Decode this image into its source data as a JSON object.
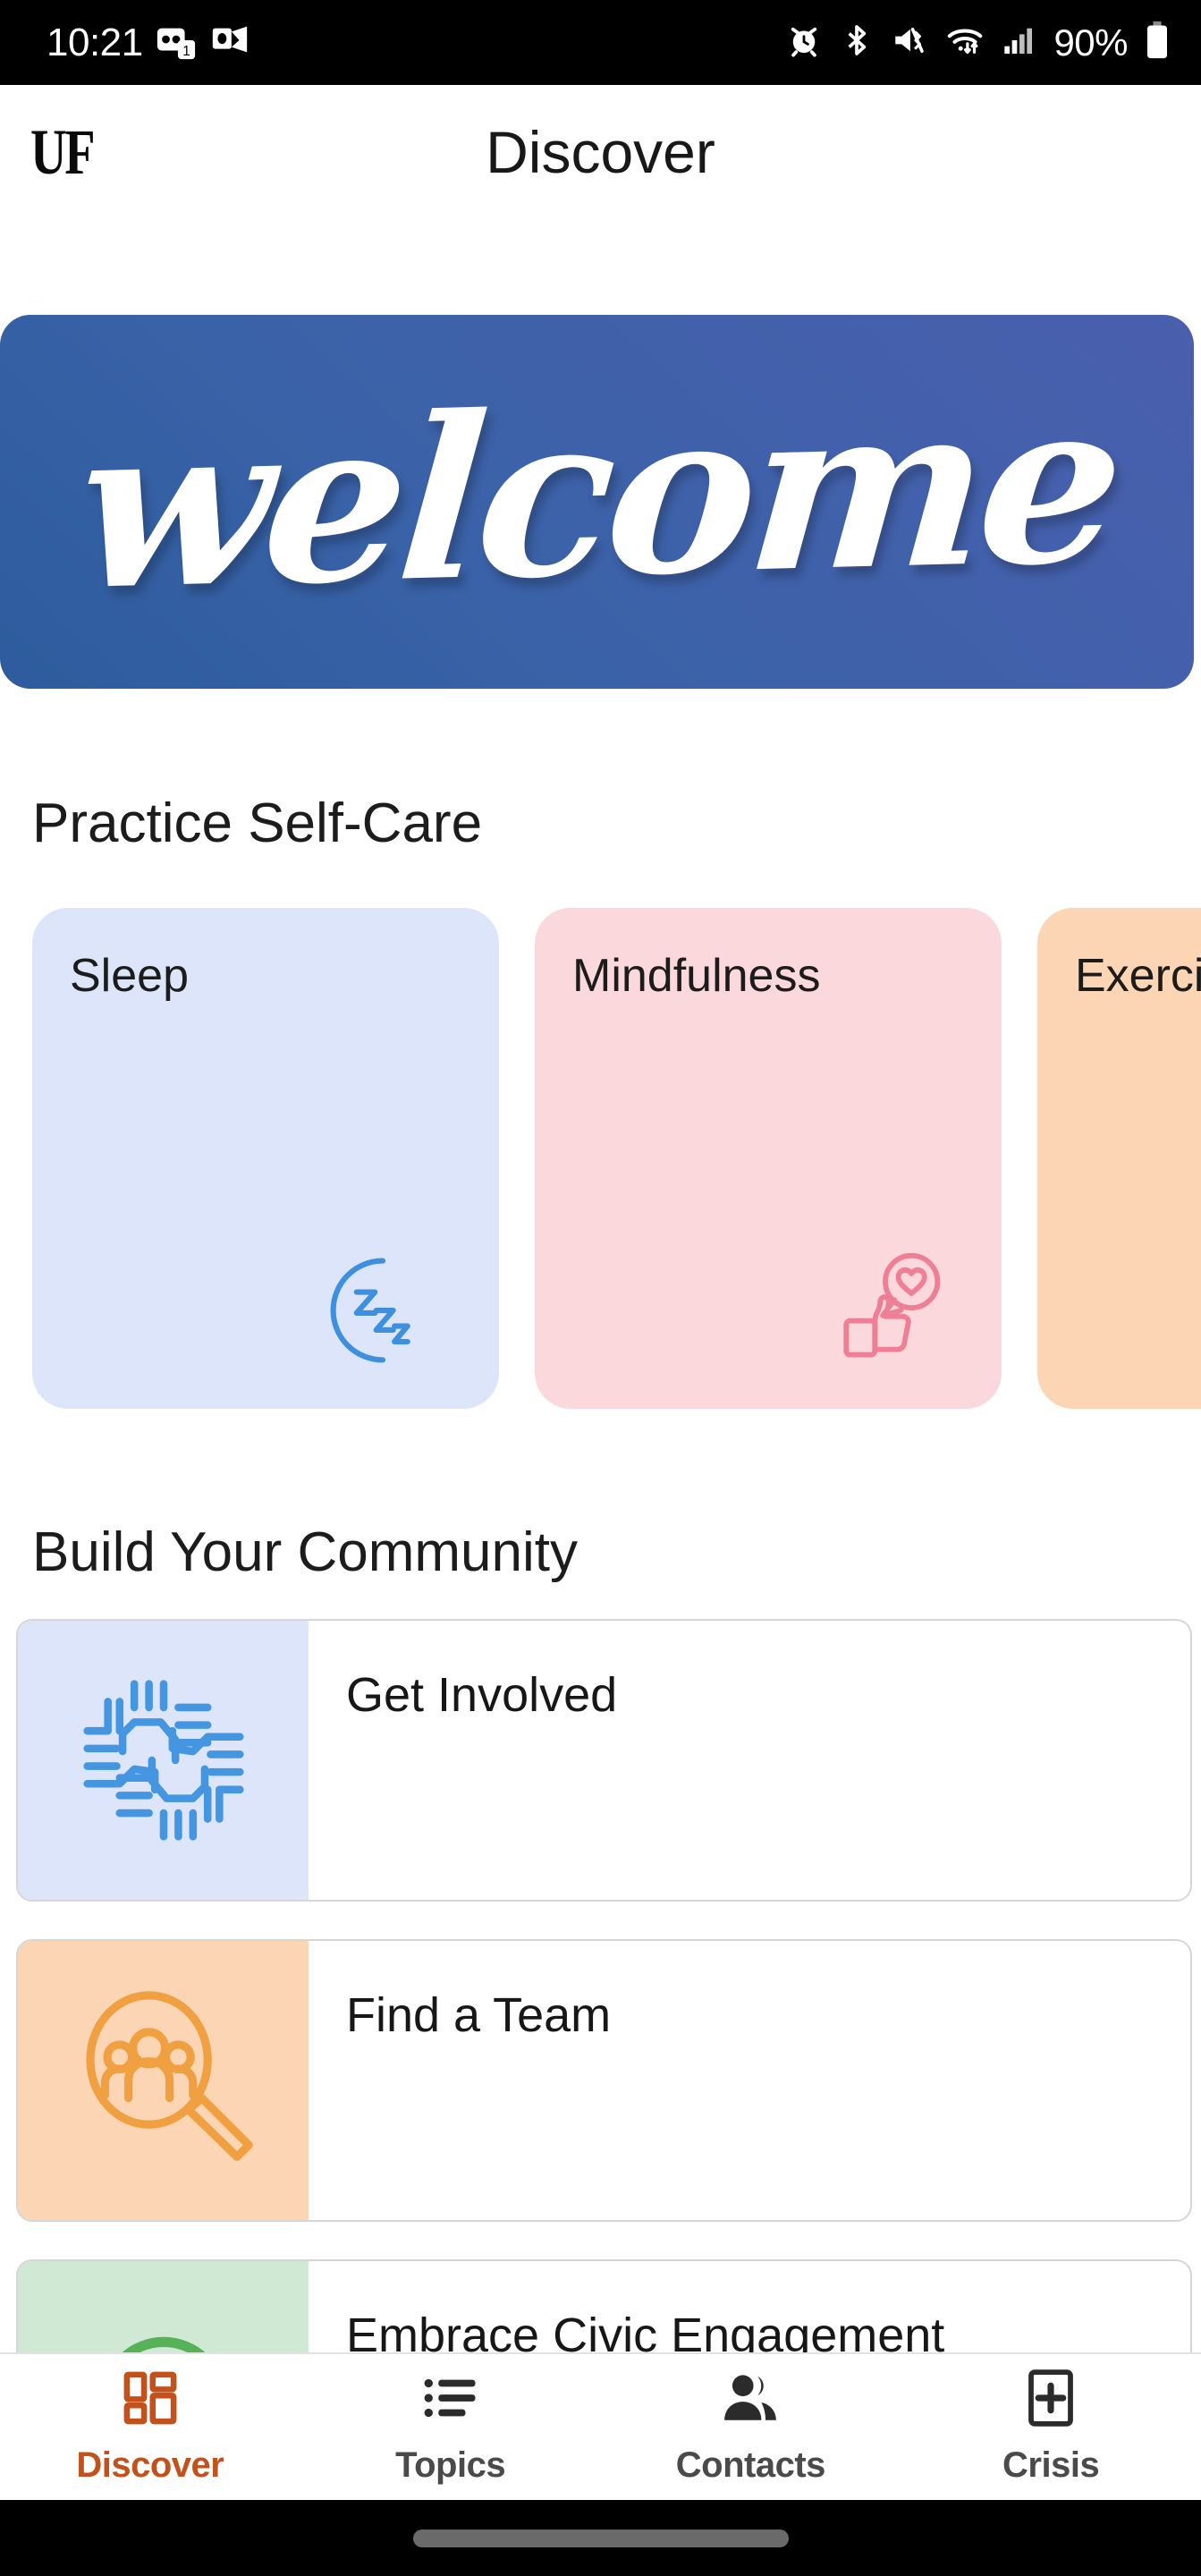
{
  "status_bar": {
    "time": "10:21",
    "battery_percent": "90%",
    "left_icons": [
      "voicemail-icon",
      "outlook-icon"
    ],
    "voicemail_badge": "1",
    "right_icons": [
      "alarm-icon",
      "bluetooth-icon",
      "mute-vibrate-icon",
      "wifi-icon",
      "cellular-signal-icon",
      "battery-icon"
    ]
  },
  "header": {
    "logo": "UF",
    "title": "Discover"
  },
  "banner": {
    "text": "welcome",
    "gradient_from": "#2d5c9d",
    "gradient_to": "#4a5fae"
  },
  "self_care": {
    "heading": "Practice Self-Care",
    "cards": [
      {
        "label": "Sleep",
        "bg": "#dde5fa",
        "accent": "#3f8fdf",
        "icon": "moon-zzz-icon"
      },
      {
        "label": "Mindfulness",
        "bg": "#fbd8dc",
        "accent": "#ef7f95",
        "icon": "thumbs-up-heart-icon"
      },
      {
        "label": "Exercise",
        "bg": "#fbd5b4",
        "accent": "#f0a040",
        "icon": "exercise-icon"
      }
    ]
  },
  "community": {
    "heading": "Build Your Community",
    "items": [
      {
        "label": "Get Involved",
        "bg": "#dde5fa",
        "accent": "#4596e0",
        "icon": "teamwork-hands-icon"
      },
      {
        "label": "Find a Team",
        "bg": "#fbd5b4",
        "accent": "#f0a040",
        "icon": "magnifier-people-icon"
      },
      {
        "label": "Embrace Civic Engagement",
        "bg": "#cfe9d4",
        "accent": "#56b256",
        "icon": "civic-engagement-icon"
      }
    ]
  },
  "bottom_nav": {
    "active_color": "#c2511c",
    "items": [
      {
        "label": "Discover",
        "icon": "grid-dashboard-icon",
        "active": true
      },
      {
        "label": "Topics",
        "icon": "list-icon",
        "active": false
      },
      {
        "label": "Contacts",
        "icon": "people-icon",
        "active": false
      },
      {
        "label": "Crisis",
        "icon": "medical-plus-icon",
        "active": false
      }
    ]
  }
}
